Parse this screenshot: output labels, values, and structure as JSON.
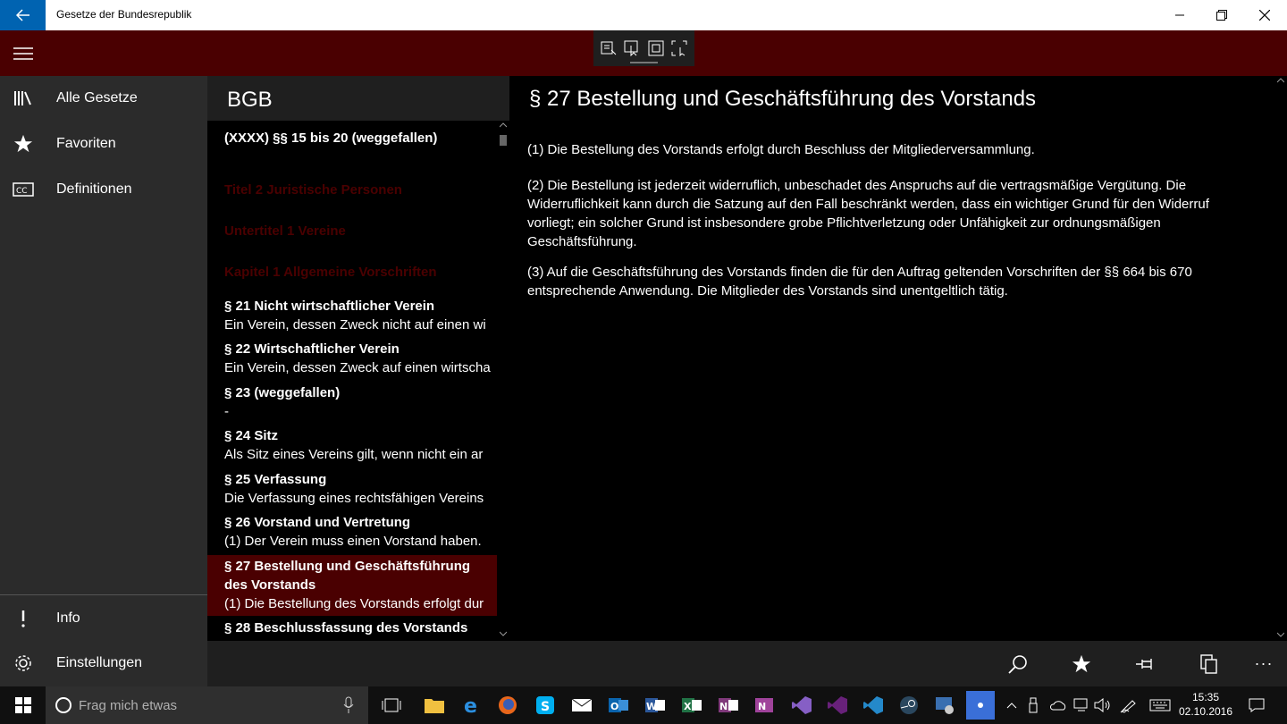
{
  "window": {
    "title": "Gesetze der Bundesrepublik"
  },
  "nav": {
    "items": [
      {
        "label": "Alle Gesetze",
        "icon": "library-icon"
      },
      {
        "label": "Favoriten",
        "icon": "star-icon"
      },
      {
        "label": "Definitionen",
        "icon": "closed-caption-icon"
      }
    ],
    "bottom": [
      {
        "label": "Info",
        "icon": "info-icon"
      },
      {
        "label": "Einstellungen",
        "icon": "gear-icon"
      }
    ]
  },
  "list": {
    "header": "BGB",
    "items": [
      {
        "kind": "entry",
        "title": "(XXXX) §§ 15 bis 20 (weggefallen)",
        "sub": ""
      },
      {
        "kind": "heading",
        "title": "Titel 2 Juristische Personen"
      },
      {
        "kind": "heading",
        "title": "Untertitel 1 Vereine"
      },
      {
        "kind": "heading",
        "title": "Kapitel 1 Allgemeine Vorschriften"
      },
      {
        "kind": "entry",
        "title": "§ 21 Nicht wirtschaftlicher Verein",
        "sub": "Ein Verein, dessen Zweck nicht auf einen wi"
      },
      {
        "kind": "entry",
        "title": "§ 22 Wirtschaftlicher Verein",
        "sub": "Ein Verein, dessen Zweck auf einen wirtscha"
      },
      {
        "kind": "entry",
        "title": "§ 23 (weggefallen)",
        "sub": "-"
      },
      {
        "kind": "entry",
        "title": "§ 24 Sitz",
        "sub": "Als Sitz eines Vereins gilt, wenn nicht ein ar"
      },
      {
        "kind": "entry",
        "title": "§ 25 Verfassung",
        "sub": "Die Verfassung eines rechtsfähigen Vereins"
      },
      {
        "kind": "entry",
        "title": "§ 26 Vorstand und Vertretung",
        "sub": "(1) Der Verein muss einen Vorstand haben."
      },
      {
        "kind": "selected",
        "title": "§ 27 Bestellung und Geschäftsführung",
        "title2": "des Vorstands",
        "sub": "(1) Die Bestellung des Vorstands erfolgt dur"
      },
      {
        "kind": "entry",
        "title": "§ 28 Beschlussfassung des Vorstands",
        "sub": ""
      }
    ]
  },
  "content": {
    "title": "§ 27 Bestellung und Geschäftsführung des Vorstands",
    "paragraphs": [
      "(1) Die Bestellung des Vorstands erfolgt durch Beschluss der Mitgliederversammlung.",
      "(2) Die Bestellung ist jederzeit widerruflich, unbeschadet des Anspruchs auf die vertragsmäßige Vergütung. Die Widerruflichkeit kann durch die Satzung auf den Fall beschränkt werden, dass ein wichtiger Grund für den Widerruf vorliegt; ein solcher Grund ist insbesondere grobe Pflichtverletzung oder Unfähigkeit zur ordnungsmäßigen Geschäftsführung.",
      "(3) Auf die Geschäftsführung des Vorstands finden die für den Auftrag geltenden Vorschriften der §§ 664 bis 670 entsprechende Anwendung. Die Mitglieder des Vorstands sind unentgeltlich tätig."
    ]
  },
  "commandbar": {
    "buttons": [
      "search-icon",
      "star-icon",
      "pin-icon",
      "copy-icon",
      "more-icon"
    ],
    "more_label": "···"
  },
  "taskbar": {
    "search_placeholder": "Frag mich etwas",
    "time": "15:35",
    "date": "02.10.2016"
  },
  "colors": {
    "accent": "#4a0001",
    "back_button": "#0063b1"
  }
}
